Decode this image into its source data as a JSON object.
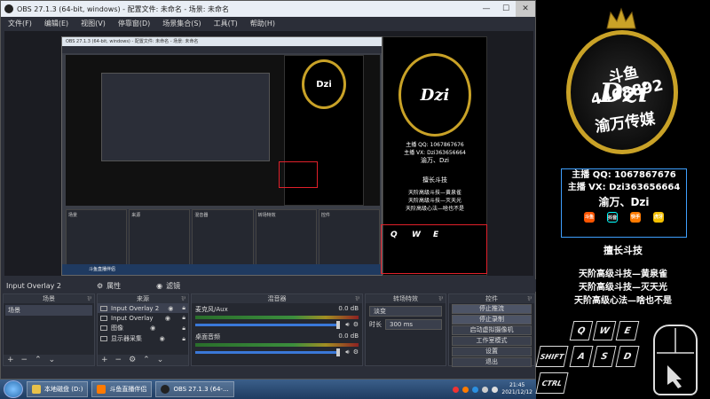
{
  "window": {
    "title": "OBS 27.1.3 (64-bit, windows) - 配置文件: 未命名 - 场景: 未命名",
    "minimize": "—",
    "maximize": "☐",
    "close": "✕"
  },
  "menu": [
    "文件(F)",
    "编辑(E)",
    "视图(V)",
    "停靠窗(D)",
    "场景集合(S)",
    "工具(T)",
    "帮助(H)"
  ],
  "status": {
    "source_name": "Input Overlay 2",
    "properties": "属性",
    "filters": "滤镜"
  },
  "docks": {
    "scenes": {
      "title": "场景",
      "items": [
        "场景"
      ]
    },
    "sources": {
      "title": "来源",
      "items": [
        {
          "name": "Input Overlay 2",
          "selected": true
        },
        {
          "name": "Input Overlay",
          "selected": false
        },
        {
          "name": "图像",
          "selected": false
        },
        {
          "name": "显示器采集",
          "selected": false
        }
      ]
    },
    "mixer": {
      "title": "混音器",
      "channels": [
        {
          "name": "麦克风/Aux",
          "db": "0.0 dB"
        },
        {
          "name": "桌面音频",
          "db": "0.0 dB"
        }
      ]
    },
    "transitions": {
      "title": "转场特效",
      "type": "淡变",
      "duration_label": "时长",
      "duration": "300 ms"
    },
    "controls": {
      "title": "控件",
      "buttons": [
        "停止推流",
        "停止录制",
        "启动虚拟摄像机",
        "工作室模式",
        "设置",
        "退出"
      ]
    }
  },
  "taskbar": {
    "items": [
      "本地磁盘 (D:)",
      "斗鱼直播伴侣",
      "OBS 27.1.3 (64-..."
    ],
    "time": "21:45",
    "date": "2021/12/12"
  },
  "poster": {
    "number": "斗鱼4468892",
    "brand": "Dzi",
    "media": "渝万传媒",
    "qq": "主播 QQ: 1067867676",
    "vx": "主播 VX: Dzi363656664",
    "name": "渝万、Dzi",
    "apps": [
      "斗鱼",
      "抖音",
      "快手",
      "虎牙"
    ],
    "skill_title": "擅长斗技",
    "skills": [
      "天阶高级斗技—黄泉雀",
      "天阶高级斗技—灭天光",
      "天阶高级心法—啥也不是"
    ],
    "keys": [
      "Q",
      "W",
      "E",
      "A",
      "S",
      "D",
      "SHIFT",
      "CTRL"
    ],
    "colors": {
      "gold": "#c9a227",
      "blue_border": "#3fa0ff",
      "red_highlight": "#e0202a"
    }
  }
}
